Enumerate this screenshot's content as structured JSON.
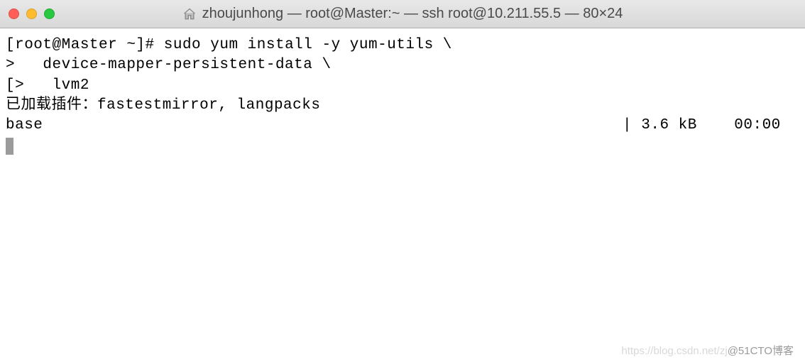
{
  "titlebar": {
    "title": "zhoujunhong — root@Master:~ — ssh root@10.211.55.5 — 80×24"
  },
  "terminal": {
    "line1_prompt": "[root@Master ~]# ",
    "line1_cmd": "sudo yum install -y yum-utils \\",
    "line2": ">   device-mapper-persistent-data \\",
    "line3": "[>   lvm2",
    "line4": "已加载插件：fastestmirror, langpacks",
    "status_left": "base",
    "status_right": "| 3.6 kB    00:00  "
  },
  "watermark": {
    "faint": "https://blog.csdn.net/zj",
    "dark": "@51CTO博客"
  }
}
